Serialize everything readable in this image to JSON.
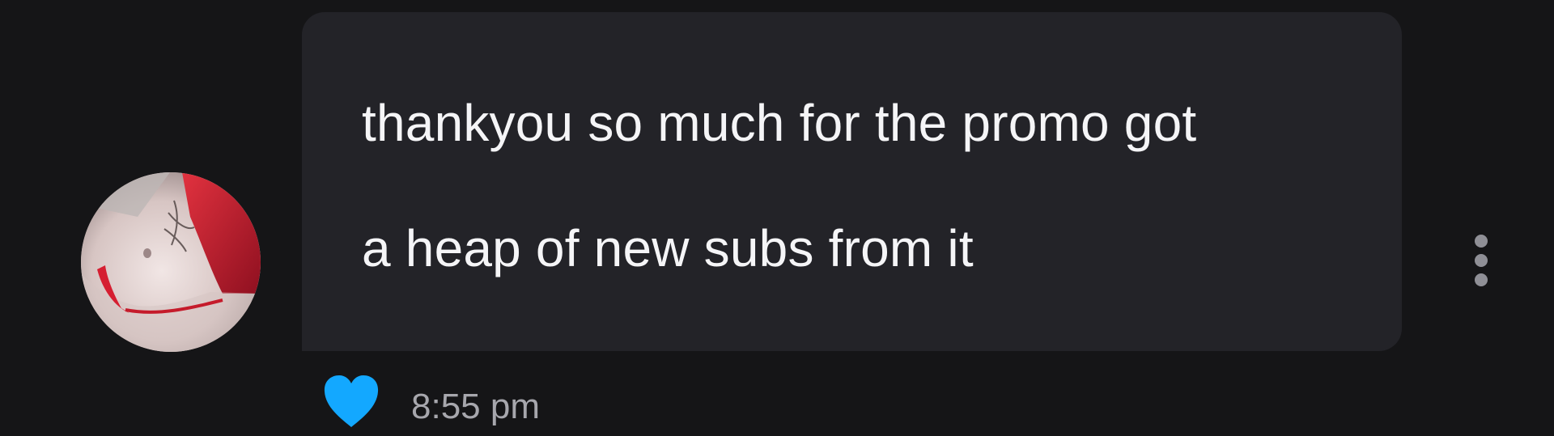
{
  "message": {
    "text_line_1": "thankyou so much for the promo got",
    "text_line_2": "a heap of new subs from it",
    "time": "8:55 pm",
    "liked": true
  },
  "icons": {
    "avatar": "profile-photo",
    "like": "heart-icon",
    "more": "vertical-ellipsis-icon"
  },
  "colors": {
    "background": "#151517",
    "bubble": "#232328",
    "message_text": "#f5f5f7",
    "time_text": "#a7a7ad",
    "like_heart": "#13a8ff",
    "more_dots": "#8f8f96"
  }
}
